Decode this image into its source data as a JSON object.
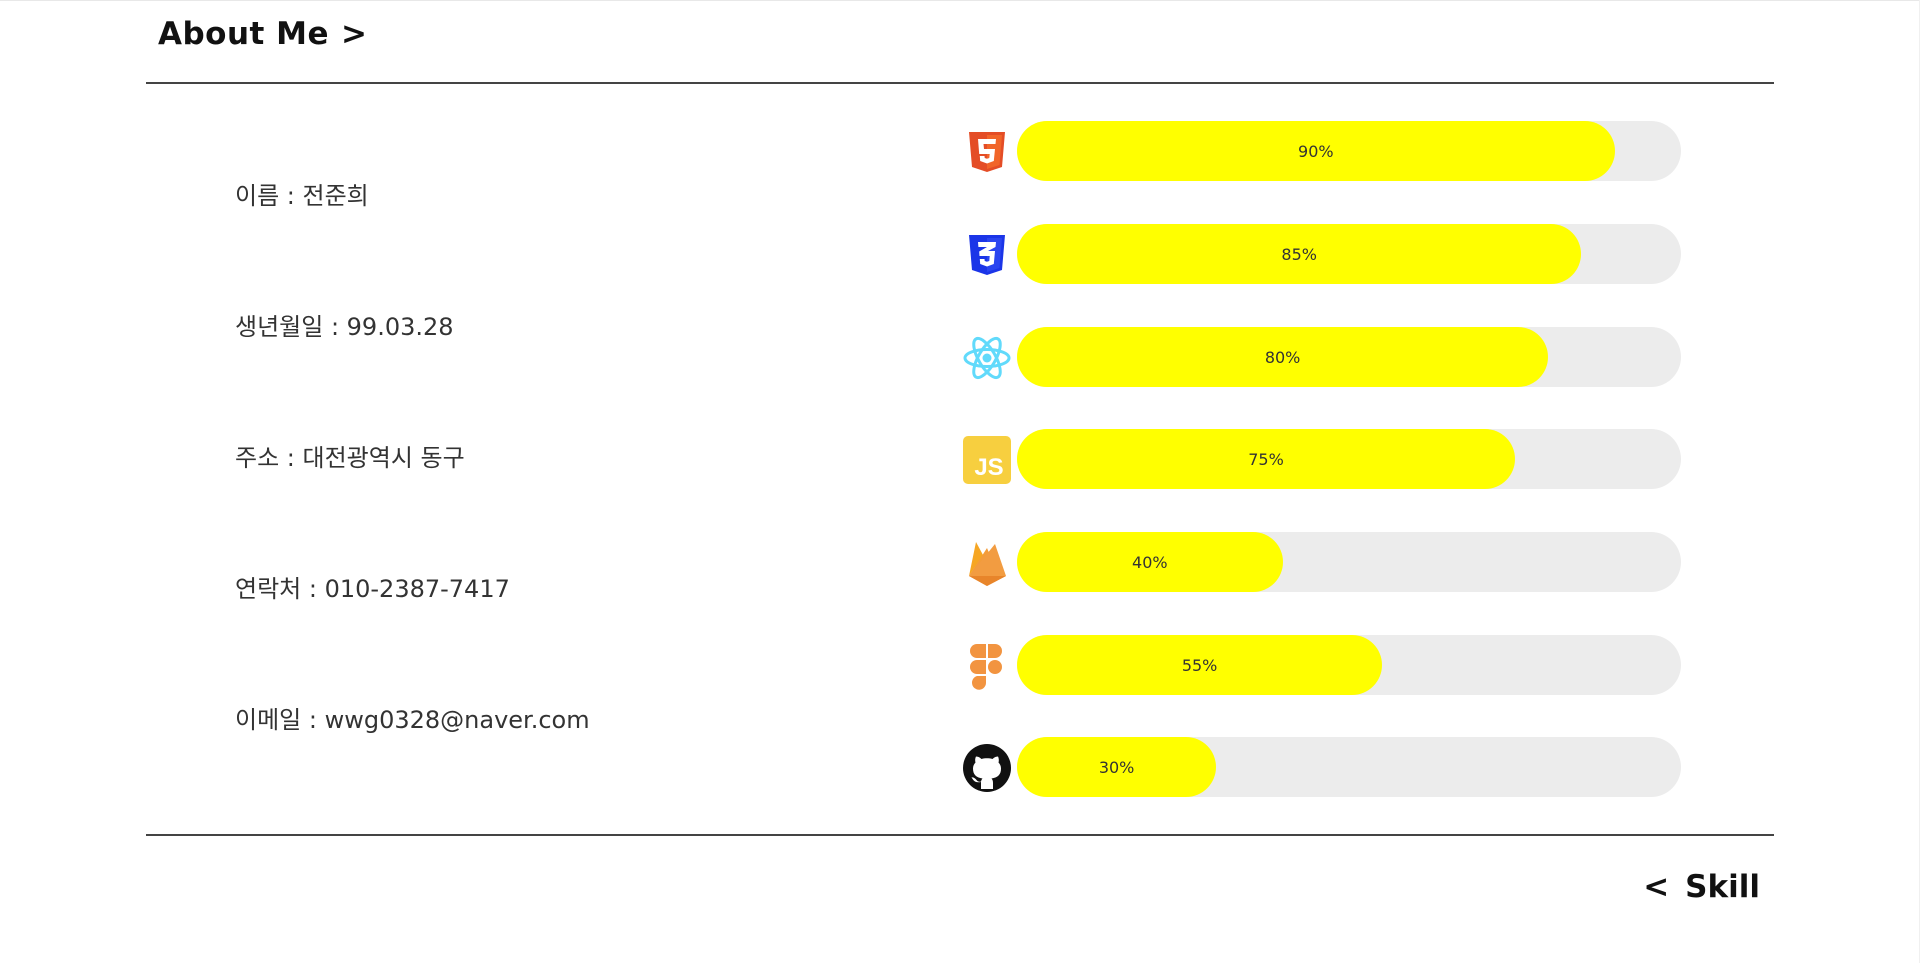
{
  "header": {
    "title": "About Me",
    "arrow": ">"
  },
  "info": {
    "items": [
      {
        "label": "이름 : 전준희"
      },
      {
        "label": "생년월일 : 99.03.28"
      },
      {
        "label": "주소 : 대전광역시 동구"
      },
      {
        "label": "연락처 : 010-2387-7417"
      },
      {
        "label": "이메일 : wwg0328@naver.com"
      }
    ]
  },
  "skills": [
    {
      "icon": "html5-icon",
      "percent": 90,
      "label": "90%"
    },
    {
      "icon": "css3-icon",
      "percent": 85,
      "label": "85%"
    },
    {
      "icon": "react-icon",
      "percent": 80,
      "label": "80%"
    },
    {
      "icon": "javascript-icon",
      "percent": 75,
      "label": "75%"
    },
    {
      "icon": "firebase-icon",
      "percent": 40,
      "label": "40%"
    },
    {
      "icon": "figma-icon",
      "percent": 55,
      "label": "55%"
    },
    {
      "icon": "github-icon",
      "percent": 30,
      "label": "30%"
    }
  ],
  "footer": {
    "arrow": "<",
    "label": "Skill"
  },
  "colors": {
    "bar_fill": "#ffff00",
    "bar_track": "#ececec",
    "divider": "#444444"
  }
}
